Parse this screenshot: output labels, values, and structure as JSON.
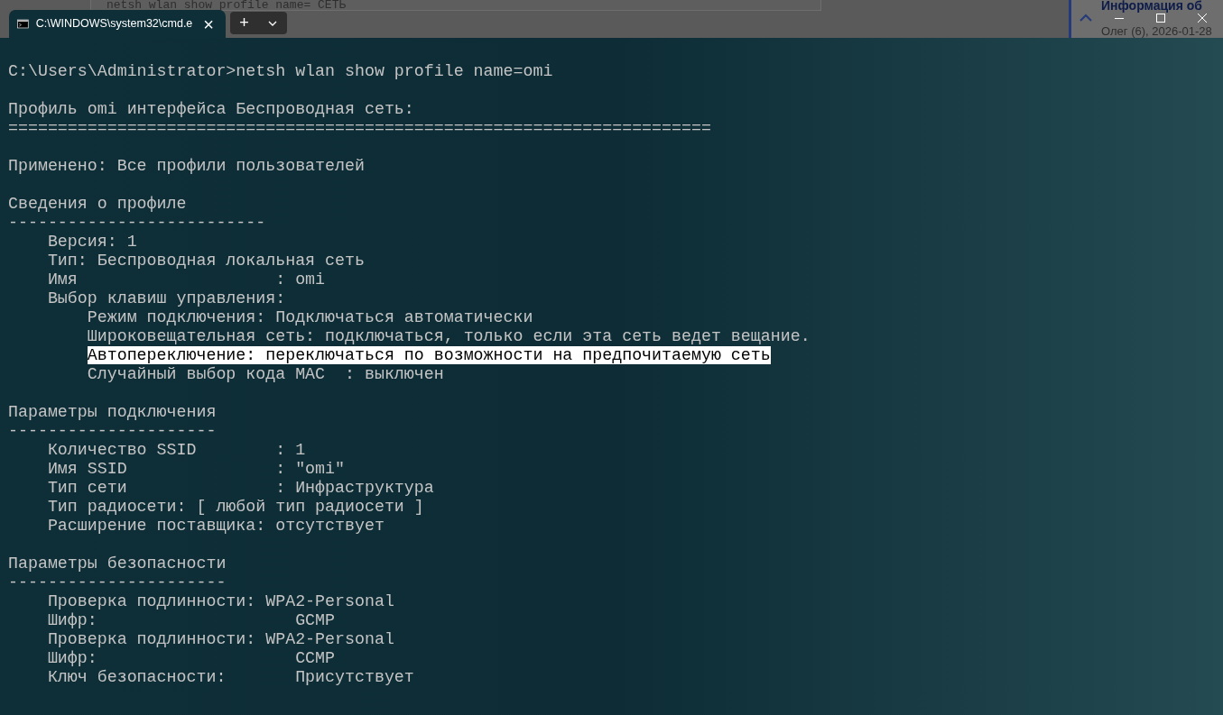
{
  "background": {
    "window_text": "netsh wlan show profile name= СЕТЬ",
    "panel_title": "Информация об",
    "panel_meta": "Олег (6), 2026-01-28"
  },
  "tabs": [
    {
      "title": "C:\\WINDOWS\\system32\\cmd.e",
      "selected": true,
      "close": "×"
    }
  ],
  "new_tab": "+",
  "terminal": {
    "blocks": [
      {
        "lines": [
          {
            "text": "C:\\Users\\Administrator>netsh wlan show profile name=omi",
            "highlighted": false
          }
        ]
      },
      {
        "lines": [
          {
            "text": "Профиль omi интерфейса Беспроводная сеть:",
            "highlighted": false
          },
          {
            "text": "=======================================================================",
            "highlighted": false
          }
        ]
      },
      {
        "lines": [
          {
            "text": "Применено: Все профили пользователей",
            "highlighted": false
          }
        ]
      },
      {
        "lines": [
          {
            "text": "Сведения о профиле",
            "highlighted": false
          },
          {
            "text": "--------------------------",
            "highlighted": false
          },
          {
            "text": "    Версия: 1",
            "highlighted": false
          },
          {
            "text": "    Тип: Беспроводная локальная сеть",
            "highlighted": false
          },
          {
            "text": "    Имя                    : omi",
            "highlighted": false
          },
          {
            "text": "    Выбор клавиш управления:",
            "highlighted": false
          },
          {
            "text": "        Режим подключения: Подключаться автоматически",
            "highlighted": false
          },
          {
            "text": "        Широковещательная сеть: подключаться, только если эта сеть ведет вещание.",
            "highlighted": false
          },
          {
            "text": "        Автопереключение: переключаться по возможности на предпочитаемую сеть",
            "highlighted": true
          },
          {
            "text": "        Случайный выбор кода MAC  : выключен",
            "highlighted": false
          }
        ]
      },
      {
        "lines": [
          {
            "text": "Параметры подключения",
            "highlighted": false
          },
          {
            "text": "---------------------",
            "highlighted": false
          },
          {
            "text": "    Количество SSID        : 1",
            "highlighted": false
          },
          {
            "text": "    Имя SSID               : \"omi\"",
            "highlighted": false
          },
          {
            "text": "    Тип сети               : Инфраструктура",
            "highlighted": false
          },
          {
            "text": "    Тип радиосети: [ любой тип радиосети ]",
            "highlighted": false
          },
          {
            "text": "    Расширение поставщика: отсутствует",
            "highlighted": false
          }
        ]
      },
      {
        "lines": [
          {
            "text": "Параметры безопасности",
            "highlighted": false
          },
          {
            "text": "----------------------",
            "highlighted": false
          },
          {
            "text": "    Проверка подлинности: WPA2-Personal",
            "highlighted": false
          },
          {
            "text": "    Шифр:                    GCMP",
            "highlighted": false
          },
          {
            "text": "    Проверка подлинности: WPA2-Personal",
            "highlighted": false
          },
          {
            "text": "    Шифр:                    CCMP",
            "highlighted": false
          },
          {
            "text": "    Ключ безопасности:       Присутствует",
            "highlighted": false
          }
        ]
      }
    ]
  }
}
